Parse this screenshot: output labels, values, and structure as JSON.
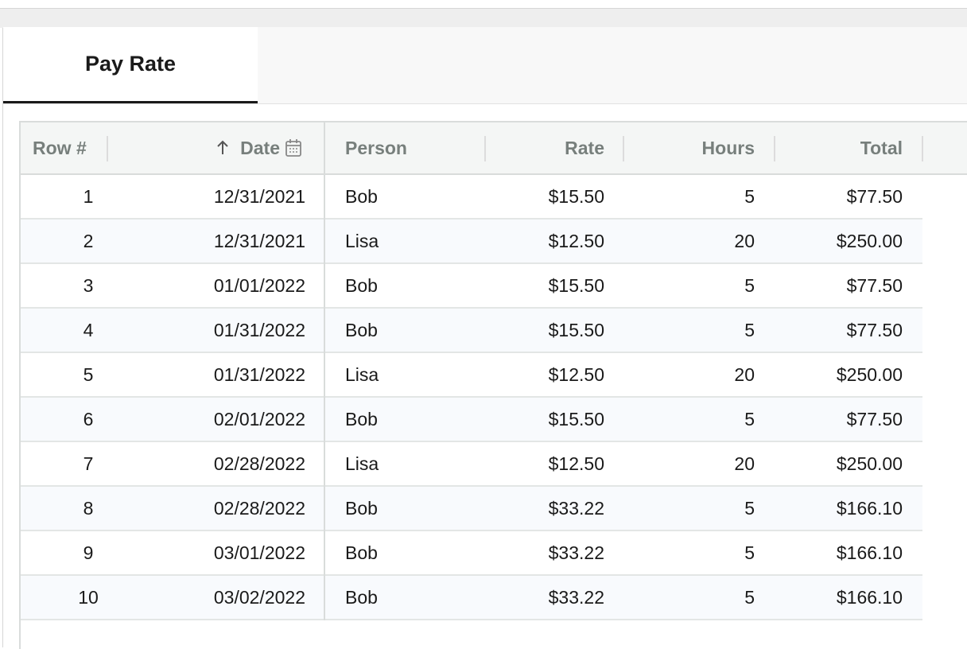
{
  "tabs": [
    {
      "label": "Pay Rate"
    }
  ],
  "table": {
    "columns": [
      {
        "label": "Row #"
      },
      {
        "label": "Date",
        "sort": "ascending"
      },
      {
        "label": "Person"
      },
      {
        "label": "Rate"
      },
      {
        "label": "Hours"
      },
      {
        "label": "Total"
      }
    ],
    "rows": [
      {
        "row": "1",
        "date": "12/31/2021",
        "person": "Bob",
        "rate": "$15.50",
        "hours": "5",
        "total": "$77.50"
      },
      {
        "row": "2",
        "date": "12/31/2021",
        "person": "Lisa",
        "rate": "$12.50",
        "hours": "20",
        "total": "$250.00"
      },
      {
        "row": "3",
        "date": "01/01/2022",
        "person": "Bob",
        "rate": "$15.50",
        "hours": "5",
        "total": "$77.50"
      },
      {
        "row": "4",
        "date": "01/31/2022",
        "person": "Bob",
        "rate": "$15.50",
        "hours": "5",
        "total": "$77.50"
      },
      {
        "row": "5",
        "date": "01/31/2022",
        "person": "Lisa",
        "rate": "$12.50",
        "hours": "20",
        "total": "$250.00"
      },
      {
        "row": "6",
        "date": "02/01/2022",
        "person": "Bob",
        "rate": "$15.50",
        "hours": "5",
        "total": "$77.50"
      },
      {
        "row": "7",
        "date": "02/28/2022",
        "person": "Lisa",
        "rate": "$12.50",
        "hours": "20",
        "total": "$250.00"
      },
      {
        "row": "8",
        "date": "02/28/2022",
        "person": "Bob",
        "rate": "$33.22",
        "hours": "5",
        "total": "$166.10"
      },
      {
        "row": "9",
        "date": "03/01/2022",
        "person": "Bob",
        "rate": "$33.22",
        "hours": "5",
        "total": "$166.10"
      },
      {
        "row": "10",
        "date": "03/02/2022",
        "person": "Bob",
        "rate": "$33.22",
        "hours": "5",
        "total": "$166.10"
      }
    ]
  },
  "icons": {
    "sort": "arrow-up-icon",
    "date_type": "calendar-icon"
  },
  "colors": {
    "header_text": "#777f7c",
    "header_bg": "#f4f6f5",
    "alt_row_bg": "#f8fafd",
    "tab_underline": "#1a1a1a"
  }
}
